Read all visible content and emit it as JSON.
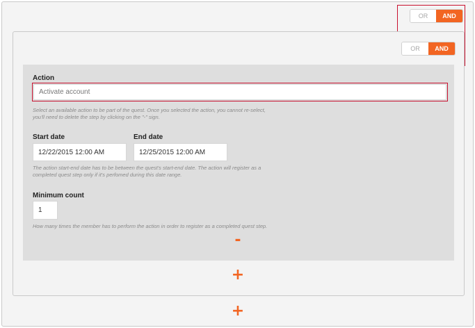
{
  "outer_toggle": {
    "or_label": "OR",
    "and_label": "AND",
    "selected": "AND"
  },
  "inner_toggle": {
    "or_label": "OR",
    "and_label": "AND",
    "selected": "AND"
  },
  "action": {
    "label": "Action",
    "value": "Activate account",
    "help_line1": "Select an available action to be part of the quest. Once you selected the action, you cannot re-select,",
    "help_line2": "you'll need to delete the step by clicking on the \"-\" sign."
  },
  "start_date": {
    "label": "Start date",
    "value": "12/22/2015 12:00 AM"
  },
  "end_date": {
    "label": "End date",
    "value": "12/25/2015 12:00 AM"
  },
  "date_help": {
    "line1": "The action start-end date has to be between the quest's start-end date. The action will register as a",
    "line2": "completed quest step only if it's perfomed during this date range."
  },
  "minimum_count": {
    "label": "Minimum count",
    "value": "1",
    "help": "How many times the member has to perform the action in order to register as a completed quest step."
  },
  "controls": {
    "remove_symbol": "-",
    "add_step_symbol": "+",
    "add_group_symbol": "+"
  },
  "colors": {
    "accent": "#f26522",
    "highlight": "#c8102e"
  }
}
